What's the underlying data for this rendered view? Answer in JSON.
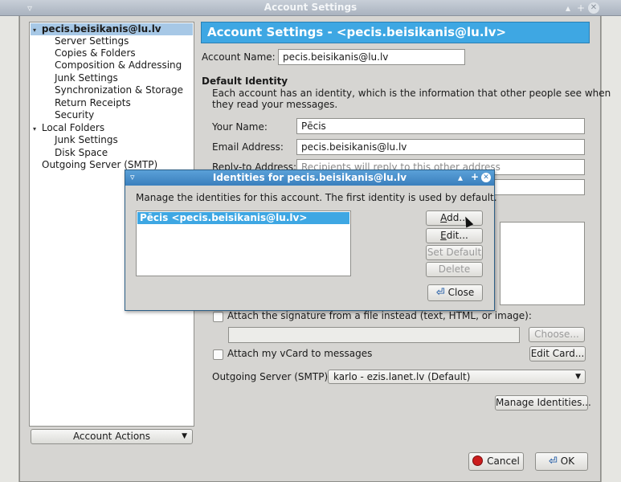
{
  "window": {
    "title": "Account Settings"
  },
  "tree": {
    "items": [
      {
        "label": "pecis.beisikanis@lu.lv",
        "level": 0,
        "expanded": true,
        "selected": true
      },
      {
        "label": "Server Settings",
        "level": 1
      },
      {
        "label": "Copies & Folders",
        "level": 1
      },
      {
        "label": "Composition & Addressing",
        "level": 1
      },
      {
        "label": "Junk Settings",
        "level": 1
      },
      {
        "label": "Synchronization & Storage",
        "level": 1
      },
      {
        "label": "Return Receipts",
        "level": 1
      },
      {
        "label": "Security",
        "level": 1
      },
      {
        "label": "Local Folders",
        "level": 0,
        "expanded": true
      },
      {
        "label": "Junk Settings",
        "level": 1
      },
      {
        "label": "Disk Space",
        "level": 1
      },
      {
        "label": "Outgoing Server (SMTP)",
        "level": 0
      }
    ],
    "account_actions": "Account Actions"
  },
  "panel": {
    "header": "Account Settings - <pecis.beisikanis@lu.lv>",
    "account_name_label": "Account Name:",
    "account_name_value": "pecis.beisikanis@lu.lv",
    "default_identity_heading": "Default Identity",
    "identity_desc_line1": "Each account has an identity, which is the information that other people see when",
    "identity_desc_line2": "they read your messages.",
    "your_name_label": "Your Name:",
    "your_name_value": "Pēcis",
    "email_label": "Email Address:",
    "email_value": "pecis.beisikanis@lu.lv",
    "reply_to_label": "Reply-to Address:",
    "reply_to_placeholder": "Recipients will reply to this other address",
    "attach_sig_label": "Attach the signature from a file instead (text, HTML, or image):",
    "choose_button": "Choose...",
    "vcard_label": "Attach my vCard to messages",
    "edit_card_button": "Edit Card...",
    "outgoing_label": "Outgoing Server (SMTP):",
    "outgoing_value": "karlo - ezis.lanet.lv (Default)",
    "manage_identities_button": "Manage Identities...",
    "cancel_button": "Cancel",
    "ok_button": "OK"
  },
  "dialog": {
    "title": "Identities for pecis.beisikanis@lu.lv",
    "description": "Manage the identities for this account. The first identity is used by default.",
    "identities": [
      "Pēcis <pecis.beisikanis@lu.lv>"
    ],
    "add_button": "Add...",
    "edit_button": "Edit...",
    "set_default_button": "Set Default",
    "delete_button": "Delete",
    "close_button": "Close"
  },
  "colors": {
    "accent": "#3ea7e3",
    "selection": "#3ea7e3",
    "titlebar": "#aab3bf"
  }
}
